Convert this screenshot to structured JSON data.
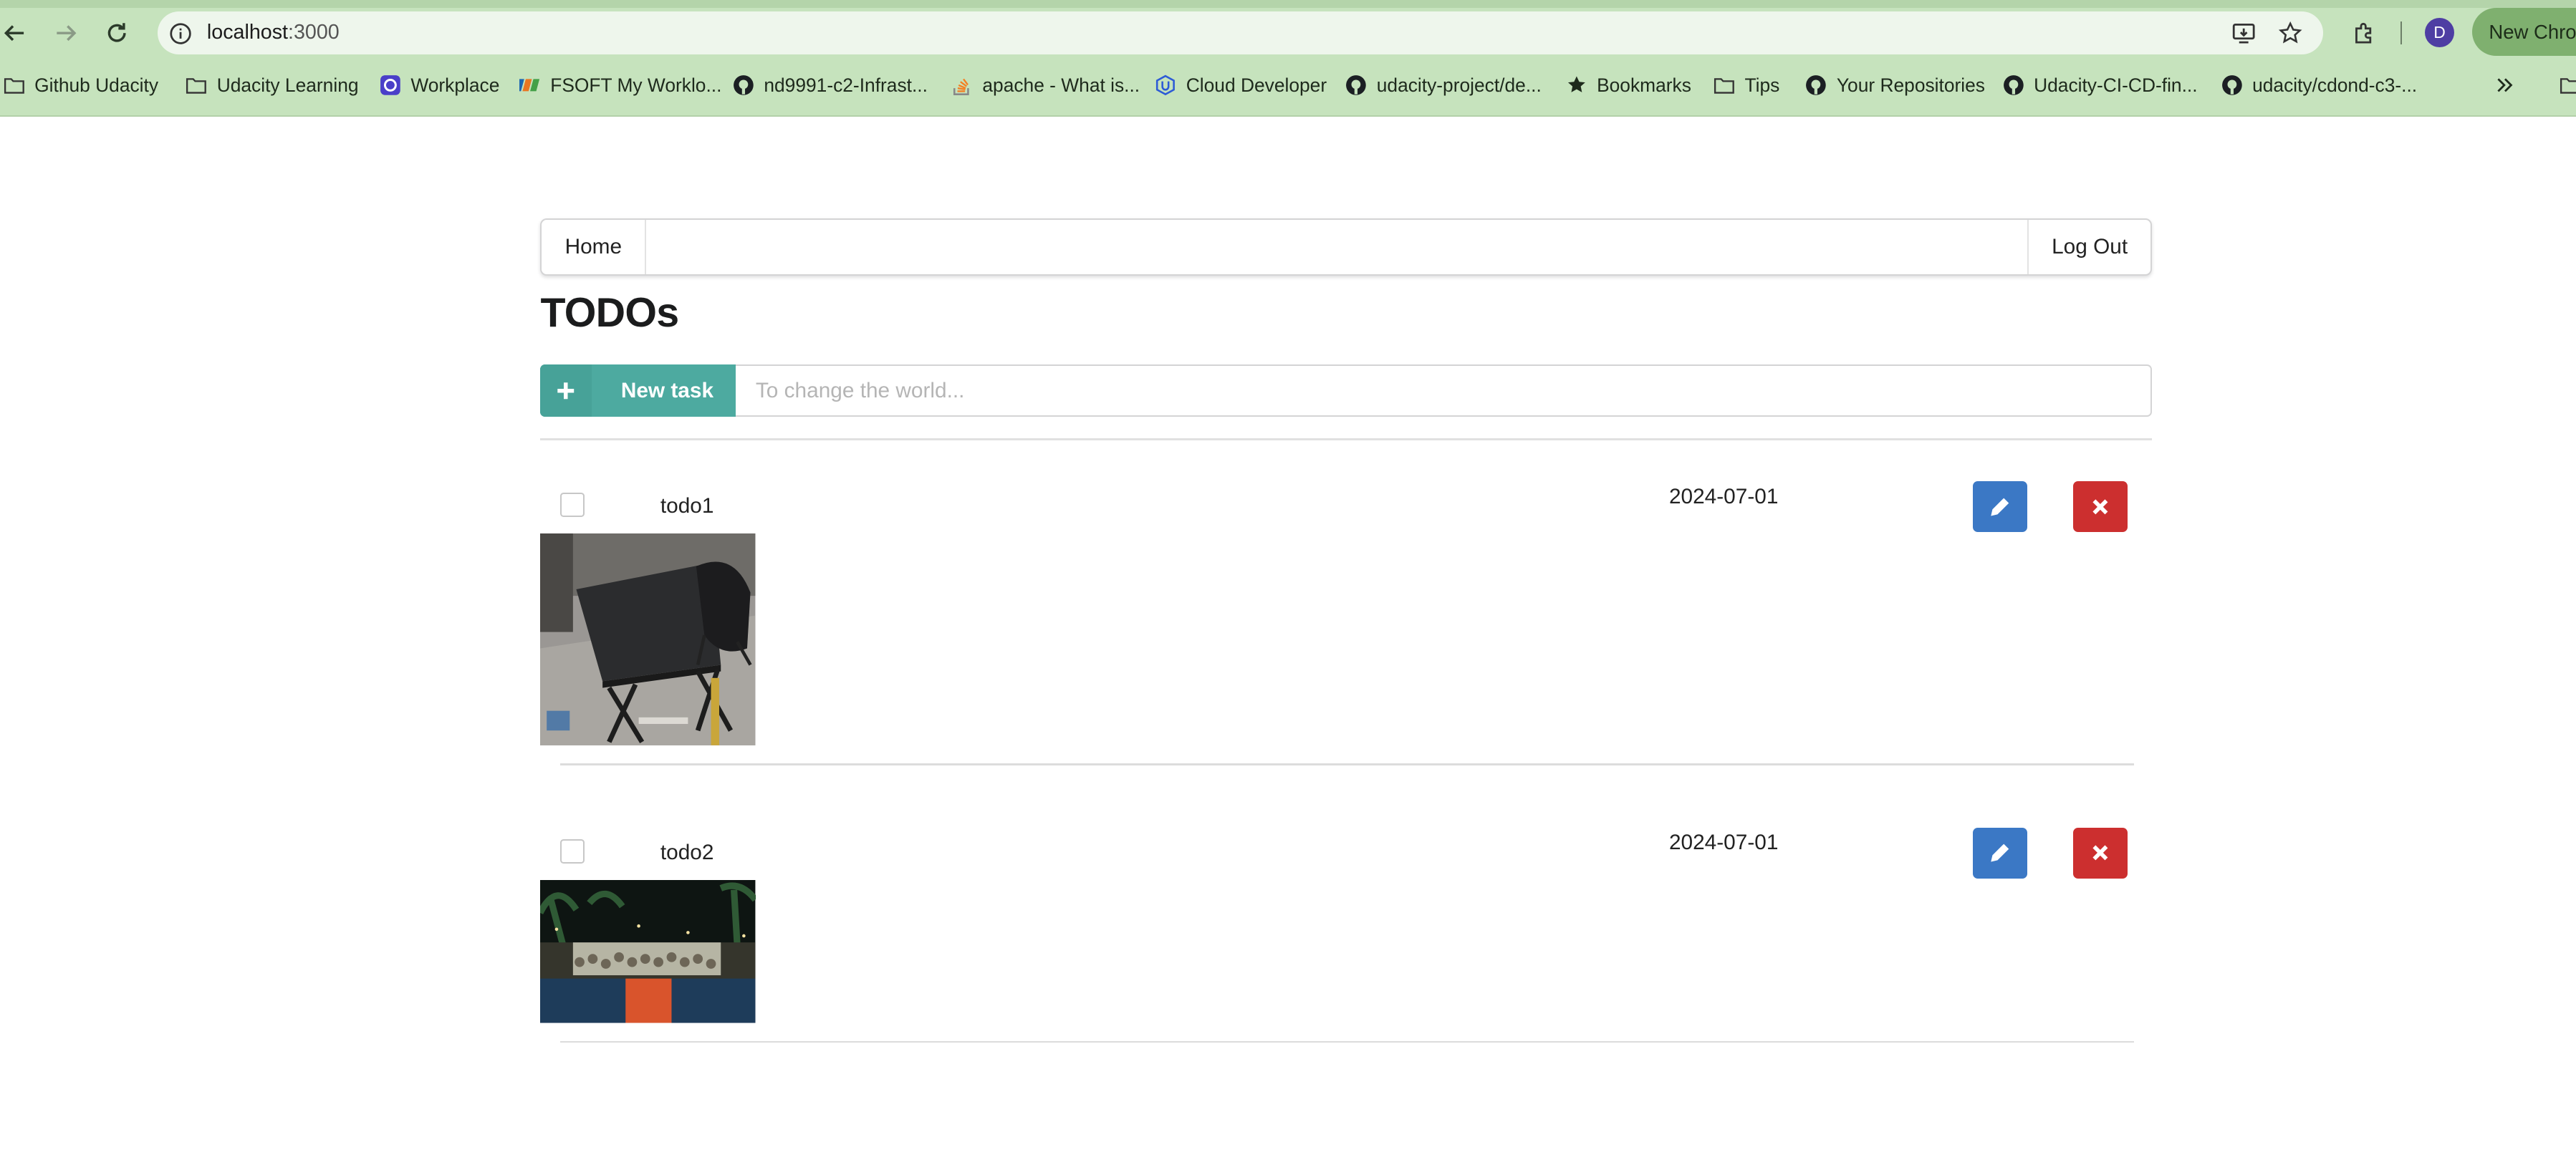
{
  "browser": {
    "url_host": "localhost",
    "url_port": ":3000",
    "profile_initial": "D",
    "new_chrome_label": "New Chro",
    "bookmarks": [
      {
        "label": "Github Udacity",
        "icon": "folder-icon"
      },
      {
        "label": "Udacity Learning",
        "icon": "folder-icon"
      },
      {
        "label": "Workplace",
        "icon": "workplace-icon"
      },
      {
        "label": "FSOFT My Worklo...",
        "icon": "fpt-icon"
      },
      {
        "label": "nd9991-c2-Infrast...",
        "icon": "github-icon"
      },
      {
        "label": "apache - What is...",
        "icon": "stackoverflow-icon"
      },
      {
        "label": "Cloud Developer",
        "icon": "udacity-icon"
      },
      {
        "label": "udacity-project/de...",
        "icon": "github-icon"
      },
      {
        "label": "Bookmarks",
        "icon": "star-icon"
      },
      {
        "label": "Tips",
        "icon": "folder-icon"
      },
      {
        "label": "Your Repositories",
        "icon": "github-icon"
      },
      {
        "label": "Udacity-CI-CD-fin...",
        "icon": "github-icon"
      },
      {
        "label": "udacity/cdond-c3-...",
        "icon": "github-icon"
      }
    ]
  },
  "menu": {
    "home_label": "Home",
    "logout_label": "Log Out"
  },
  "page": {
    "title": "TODOs"
  },
  "new_task": {
    "button_label": "New task",
    "input_value": "",
    "input_placeholder": "To change the world..."
  },
  "todos": [
    {
      "name": "todo1",
      "due_date": "2024-07-01",
      "done": false,
      "image": "office-desk-photo"
    },
    {
      "name": "todo2",
      "due_date": "2024-07-01",
      "done": false,
      "image": "night-event-photo"
    }
  ],
  "colors": {
    "accent_teal": "#4daaa0",
    "edit_blue": "#3b78c5",
    "delete_red": "#cc2f2f",
    "browser_green": "#c6e3bd"
  }
}
